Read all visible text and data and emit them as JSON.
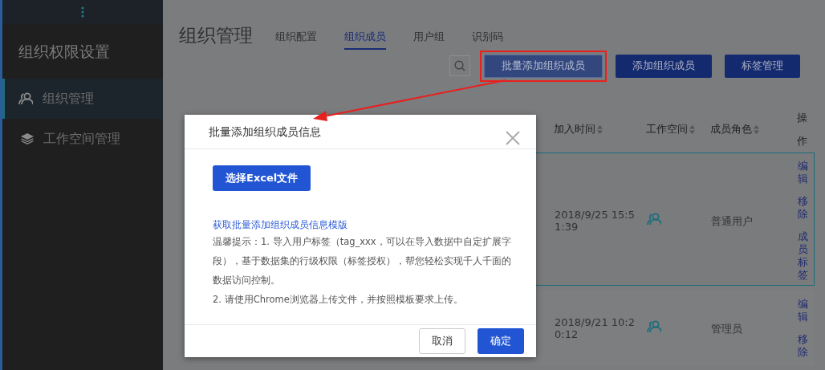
{
  "sidebar": {
    "title": "组织权限设置",
    "items": [
      {
        "label": "组织管理",
        "selected": true
      },
      {
        "label": "工作空间管理",
        "selected": false
      }
    ]
  },
  "header": {
    "title": "组织管理",
    "tabs": [
      {
        "label": "组织配置",
        "selected": false
      },
      {
        "label": "组织成员",
        "selected": true
      },
      {
        "label": "用户组",
        "selected": false
      },
      {
        "label": "识别码",
        "selected": false
      }
    ]
  },
  "toolbar": {
    "buttons": [
      {
        "label": "批量添加组织成员",
        "highlighted": true
      },
      {
        "label": "添加组织成员",
        "highlighted": false
      },
      {
        "label": "标签管理",
        "highlighted": false
      }
    ]
  },
  "table": {
    "columns": [
      "加入时间",
      "工作空间",
      "成员角色",
      "操作"
    ],
    "rows": [
      {
        "joined": "2018/9/25 15:51:39",
        "role": "普通用户",
        "actions": [
          "编辑",
          "移除",
          "成员标签"
        ],
        "selected": true
      },
      {
        "joined": "2018/9/21 10:20:12",
        "role": "管理员",
        "actions": [
          "编辑",
          "移除"
        ],
        "selected": false
      }
    ]
  },
  "dialog": {
    "title": "批量添加组织成员信息",
    "upload_button": "选择Excel文件",
    "template_link": "获取批量添加组织成员信息模版",
    "tips": [
      "温馨提示：1. 导入用户标签（tag_xxx，可以在导入数据中自定扩展字段），基于数据集的行级权限（标签授权），帮您轻松实现千人千面的数据访问控制。",
      "2. 请使用Chrome浏览器上传文件，并按照模板要求上传。"
    ],
    "buttons": [
      {
        "label": "取消",
        "kind": "secondary"
      },
      {
        "label": "确定",
        "kind": "primary"
      }
    ]
  }
}
